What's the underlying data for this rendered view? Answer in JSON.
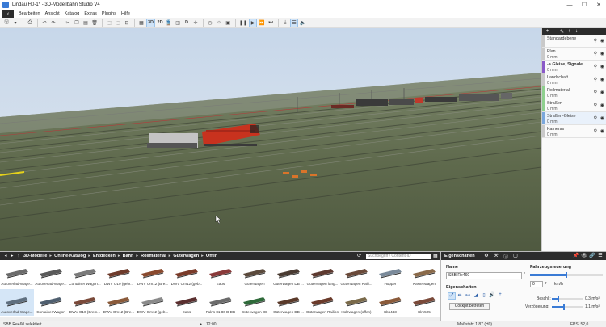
{
  "window": {
    "title": "Lindau H0-1* - 3D-Modellbahn Studio V4",
    "minimize": "—",
    "maximize": "☐",
    "restore": "⧉",
    "close": "✕"
  },
  "menu": {
    "back": "‹",
    "items": [
      "Bearbeiten",
      "Ansicht",
      "Katalog",
      "Extras",
      "Plugins",
      "Hilfe"
    ]
  },
  "toolbar": {
    "view_3d": "3D",
    "view_2d": "2D",
    "view_d": "D"
  },
  "layers": {
    "toolbar_icons": [
      "+",
      "—",
      "✎",
      "↑",
      "↓"
    ],
    "items": [
      {
        "name": "Standardebene",
        "size": "-",
        "color": "#c9c9c9",
        "bold": false,
        "selected": false
      },
      {
        "name": "Plan",
        "size": "0 mm",
        "color": "#c9c9c9",
        "bold": false,
        "selected": false
      },
      {
        "name": "-> Gleise, Signale...",
        "size": "0 mm",
        "color": "#8a5ac8",
        "bold": true,
        "selected": false
      },
      {
        "name": "Landschaft",
        "size": "0 mm",
        "color": "#c9c9c9",
        "bold": false,
        "selected": false
      },
      {
        "name": "Rollmaterial",
        "size": "0 mm",
        "color": "#8fd08f",
        "bold": false,
        "selected": false
      },
      {
        "name": "Straßen",
        "size": "0 mm",
        "color": "#8fd08f",
        "bold": false,
        "selected": false
      },
      {
        "name": "Straßen-Gleise",
        "size": "0 mm",
        "color": "#7aa7dc",
        "bold": false,
        "selected": true
      },
      {
        "name": "Kameras",
        "size": "0 mm",
        "color": "#c9c9c9",
        "bold": false,
        "selected": false
      }
    ]
  },
  "catalog": {
    "breadcrumb": [
      "3D-Modelle",
      "Online-Katalog",
      "Entdecken",
      "Bahn",
      "Rollmaterial",
      "Güterwagen",
      "Offen"
    ],
    "search_placeholder": "Suchbegriff / Content-ID",
    "items": [
      {
        "label": "Autoverlad-Wage...",
        "color": "#6b6b6b"
      },
      {
        "label": "Autoverlad-Wage...",
        "color": "#5a5a5a"
      },
      {
        "label": "Container Wagon...",
        "color": "#7a7a7a"
      },
      {
        "label": "DWV O10 (gebr...",
        "color": "#6e3b2b"
      },
      {
        "label": "DWV Om12 (Bre...",
        "color": "#8a4a2e"
      },
      {
        "label": "DWV Om12 (geb...",
        "color": "#7a3b2a"
      },
      {
        "label": "Eaos",
        "color": "#8a3a3a"
      },
      {
        "label": "Güterwagen",
        "color": "#5b4a3c"
      },
      {
        "label": "Güterwagen DB ...",
        "color": "#4a3b32"
      },
      {
        "label": "Güterwagen lang...",
        "color": "#5e3a30"
      },
      {
        "label": "Güterwagen Raili...",
        "color": "#6a4a3a"
      },
      {
        "label": "Hopper",
        "color": "#7a8a9a"
      },
      {
        "label": "Kastenwagen",
        "color": "#8a6a4a"
      },
      {
        "label": "Autoverlad-Wage...",
        "color": "#5f6f7f"
      },
      {
        "label": "Container Wagon",
        "color": "#4f5f6f"
      },
      {
        "label": "DWV O10 (Brem...",
        "color": "#7a4a3a"
      },
      {
        "label": "DWV Om12 (Bre...",
        "color": "#8a5a3a"
      },
      {
        "label": "DWV Om12 (geb...",
        "color": "#8a8a8a"
      },
      {
        "label": "Eaos",
        "color": "#5a2f2f"
      },
      {
        "label": "Falns 81 80 D DB",
        "color": "#6b6b6b"
      },
      {
        "label": "Güterwagen DB",
        "color": "#2f6a3a"
      },
      {
        "label": "Güterwagen DB ...",
        "color": "#5a3a2a"
      },
      {
        "label": "Güterwagen Railion",
        "color": "#6a3a2a"
      },
      {
        "label": "Holzwagen (offen)",
        "color": "#7a6a4a"
      },
      {
        "label": "Kbs443",
        "color": "#8a5a3a"
      },
      {
        "label": "Klm505",
        "color": "#7a4a3a"
      }
    ]
  },
  "properties": {
    "title": "Eigenschaften",
    "name_label": "Name",
    "name_value": "SBB Re460",
    "eigenschaften_label": "Eigenschaften",
    "cockpit_button": "Cockpit betreten",
    "fahrzeug_label": "Fahrzeugsteuerung",
    "speed_value": "0",
    "speed_unit": "km/h",
    "beschl_label": "Beschl.:",
    "beschl_value": "0,3 m/s²",
    "verz_label": "Verzögerung:",
    "verz_value": "1,1 m/s²",
    "fahrzeug_slider_level": 0.5,
    "beschl_slider_level": 0.2,
    "verz_slider_level": 0.4
  },
  "status": {
    "selected": "SBB Re460 selektiert",
    "time": "12:00",
    "scale": "Maßstab: 1:87 (H0)",
    "fps": "FPS: 52,0"
  },
  "colors": {
    "accent": "#3a7bd5",
    "dark_bar": "#2c2c2c",
    "locomotive": "#c8321e"
  }
}
